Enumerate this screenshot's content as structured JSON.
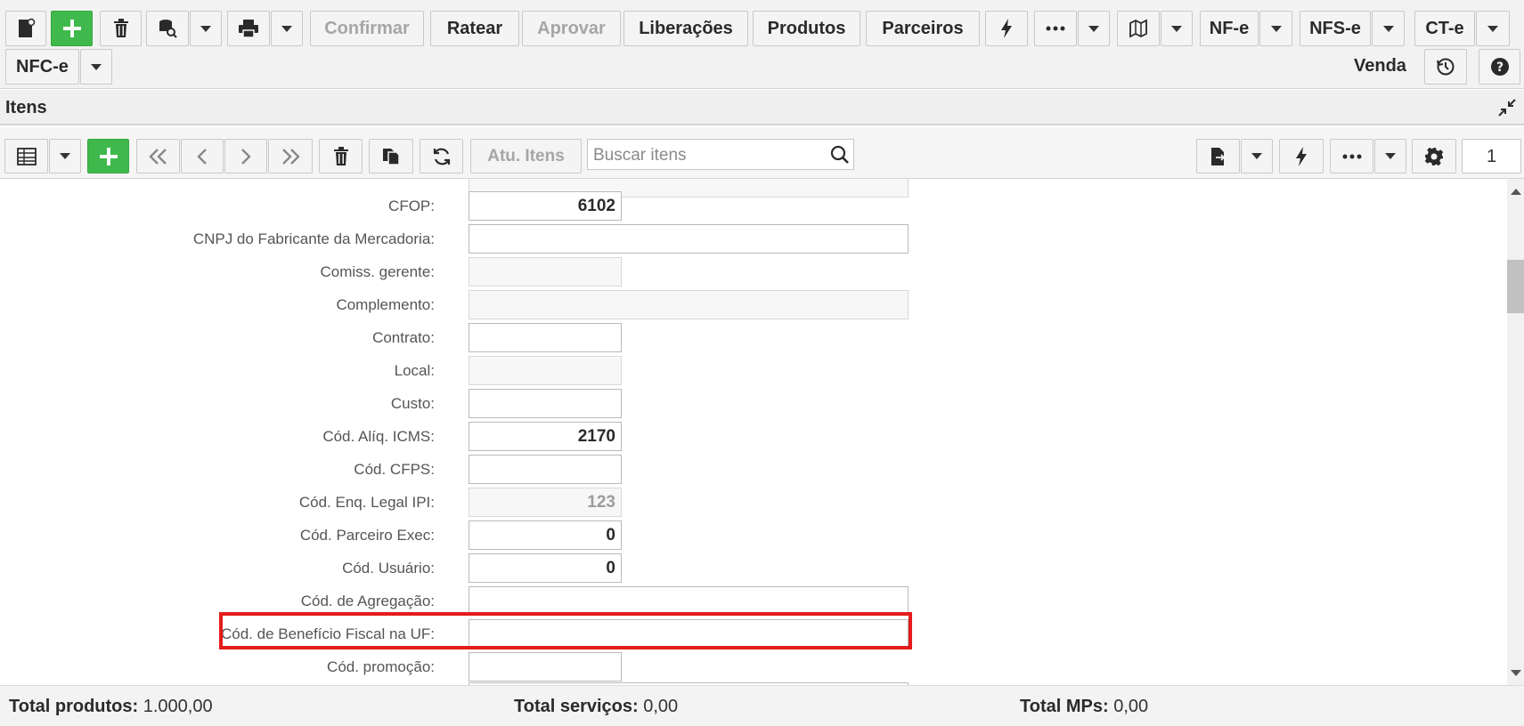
{
  "toolbar": {
    "confirm_label": "Confirmar",
    "ratear_label": "Ratear",
    "approve_label": "Aprovar",
    "liberacoes_label": "Liberações",
    "produtos_label": "Produtos",
    "parceiros_label": "Parceiros",
    "nfe_label": "NF-e",
    "nfse_label": "NFS-e",
    "cte_label": "CT-e",
    "nfce_label": "NFC-e",
    "mode_label": "Venda"
  },
  "section": {
    "title": "Itens"
  },
  "items_toolbar": {
    "update_items_label": "Atu. Itens",
    "search_placeholder": "Buscar itens",
    "page_number": "1"
  },
  "form": {
    "fields": [
      {
        "label": "CFOP:",
        "value": "6102"
      },
      {
        "label": "CNPJ do Fabricante da Mercadoria:",
        "value": ""
      },
      {
        "label": "Comiss. gerente:",
        "value": ""
      },
      {
        "label": "Complemento:",
        "value": ""
      },
      {
        "label": "Contrato:",
        "value": ""
      },
      {
        "label": "Local:",
        "value": ""
      },
      {
        "label": "Custo:",
        "value": ""
      },
      {
        "label": "Cód. Alíq. ICMS:",
        "value": "2170"
      },
      {
        "label": "Cód. CFPS:",
        "value": ""
      },
      {
        "label": "Cód. Enq. Legal IPI:",
        "value": "123"
      },
      {
        "label": "Cód. Parceiro Exec:",
        "value": "0"
      },
      {
        "label": "Cód. Usuário:",
        "value": "0"
      },
      {
        "label": "Cód. de Agregação:",
        "value": ""
      },
      {
        "label": "Cód. de Benefício Fiscal na UF:",
        "value": ""
      },
      {
        "label": "Cód. promoção:",
        "value": ""
      }
    ]
  },
  "footer": {
    "total_produtos_label": "Total produtos:",
    "total_produtos_value": "1.000,00",
    "total_servicos_label": "Total serviços:",
    "total_servicos_value": "0,00",
    "total_mps_label": "Total MPs:",
    "total_mps_value": "0,00"
  },
  "colors": {
    "accent_green": "#3fb94b",
    "highlight_red": "#e41c1c"
  }
}
